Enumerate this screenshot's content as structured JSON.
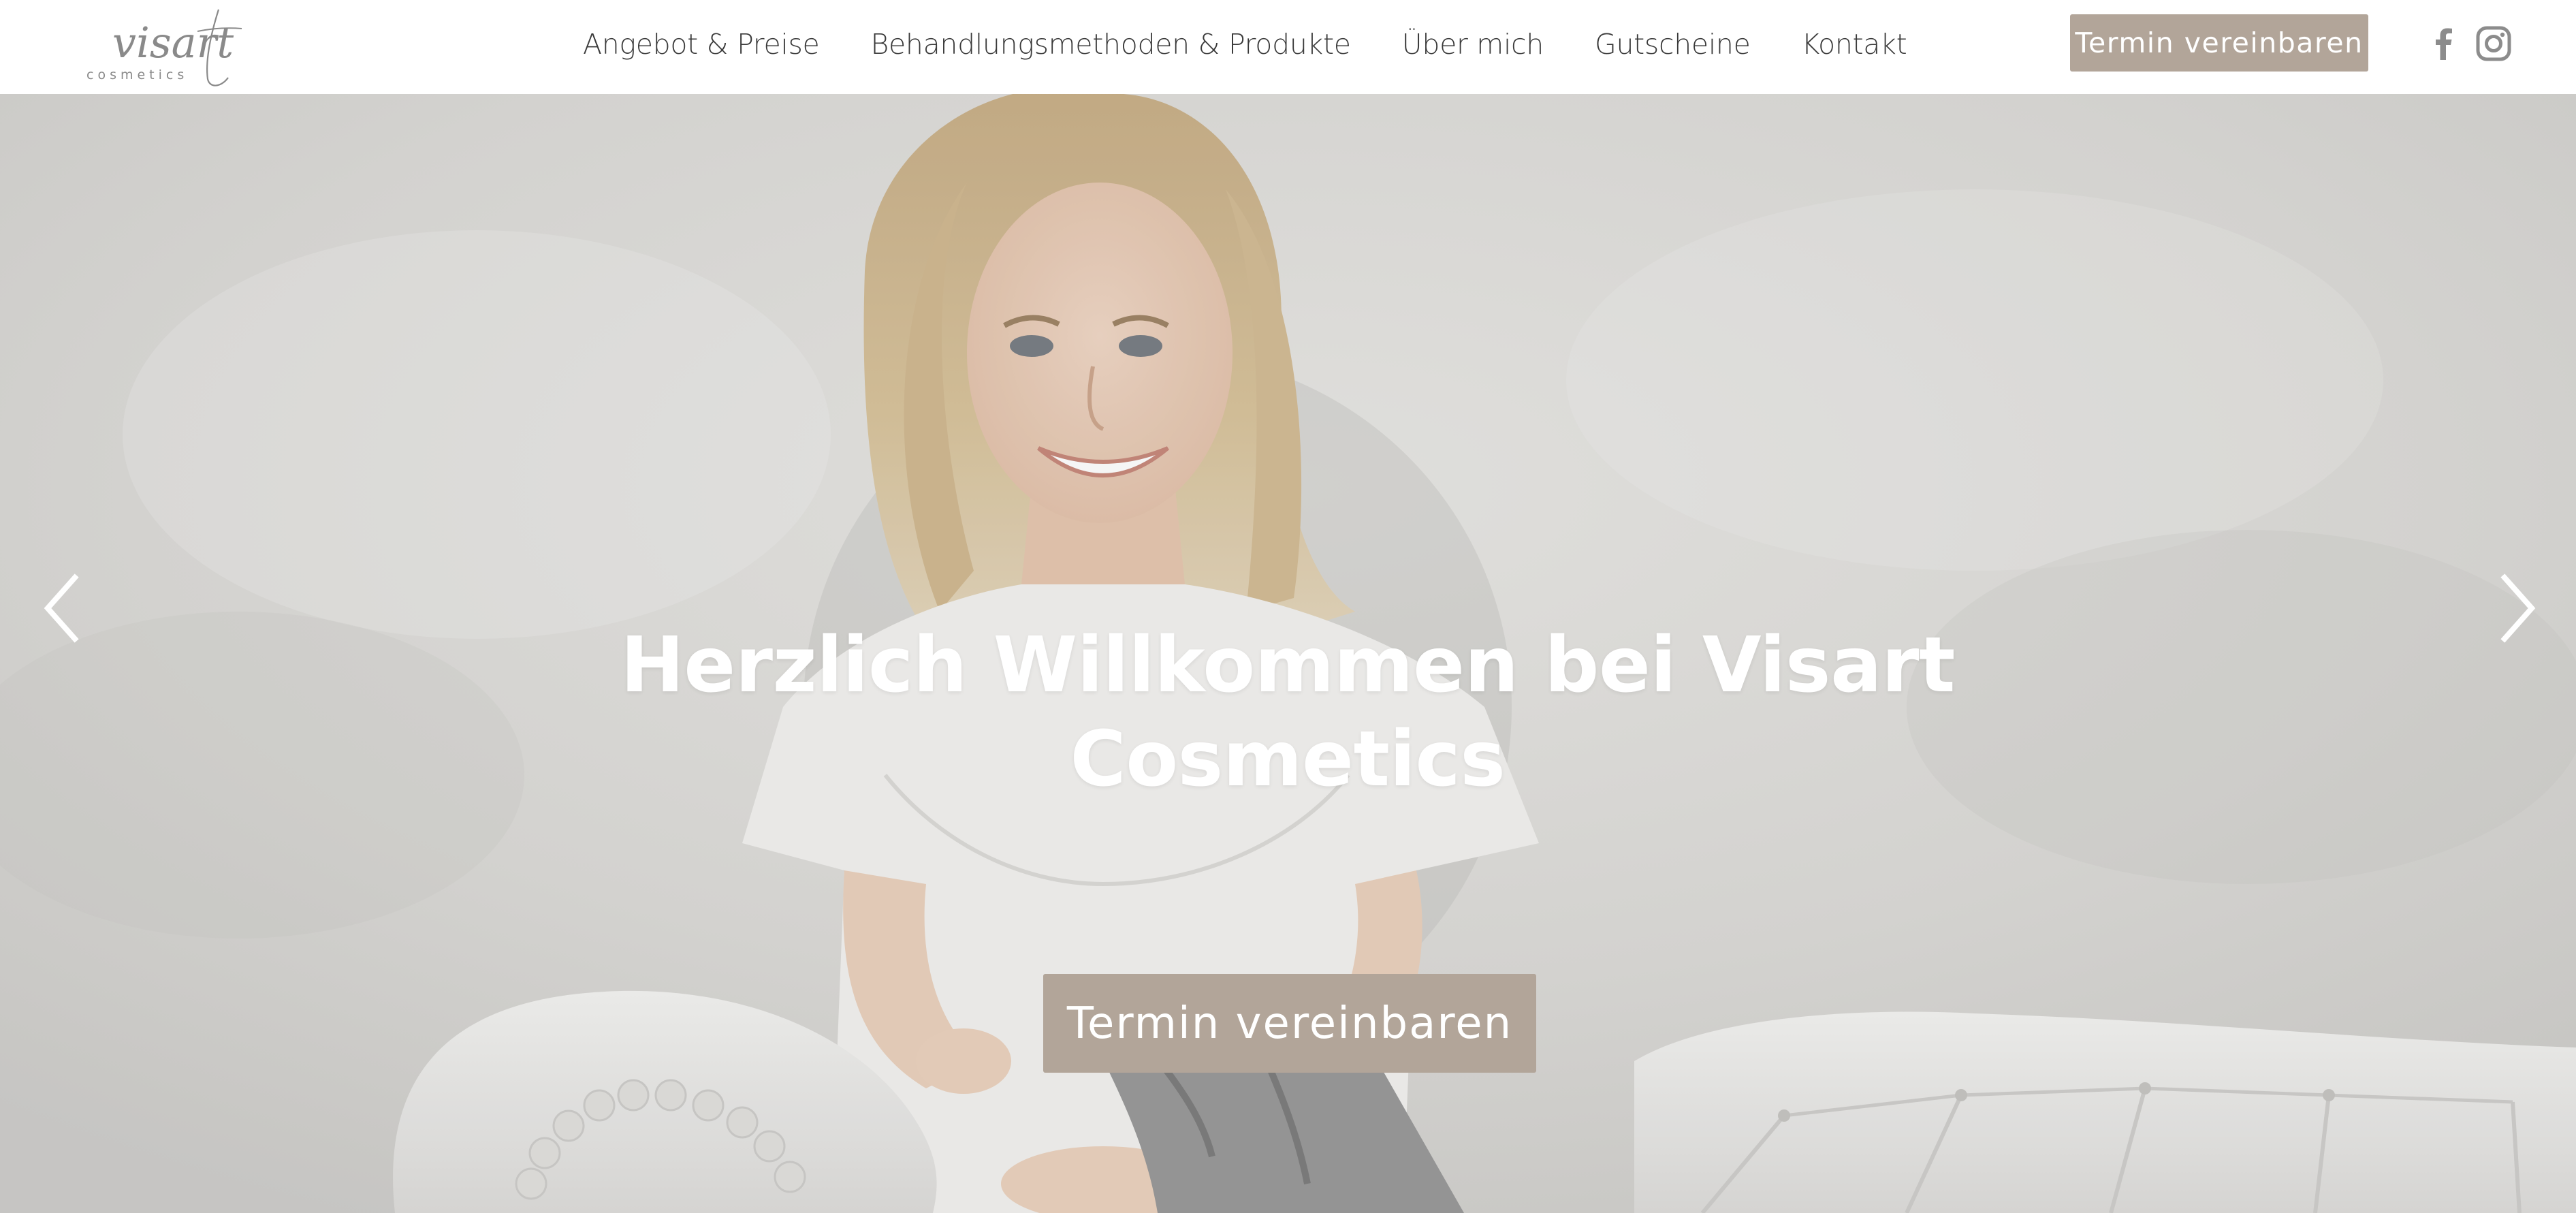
{
  "header": {
    "logo": {
      "wordmark": "visart",
      "subline": "cosmetics"
    },
    "nav": [
      {
        "label": "Angebot & Preise"
      },
      {
        "label": "Behandlungsmethoden & Produkte"
      },
      {
        "label": "Über mich"
      },
      {
        "label": "Gutscheine"
      },
      {
        "label": "Kontakt"
      }
    ],
    "cta_label": "Termin vereinbaren",
    "social": [
      {
        "icon": "facebook-icon"
      },
      {
        "icon": "instagram-icon"
      }
    ]
  },
  "hero": {
    "title": "Herzlich Willkommen bei Visart Cosmetics",
    "cta_label": "Termin vereinbaren",
    "prev_icon": "chevron-left-icon",
    "next_icon": "chevron-right-icon"
  },
  "colors": {
    "accent": "#b2a599",
    "nav_text": "#3a3a3a",
    "social_icon": "#8c8c8c",
    "logo": "#8a8a8a"
  }
}
